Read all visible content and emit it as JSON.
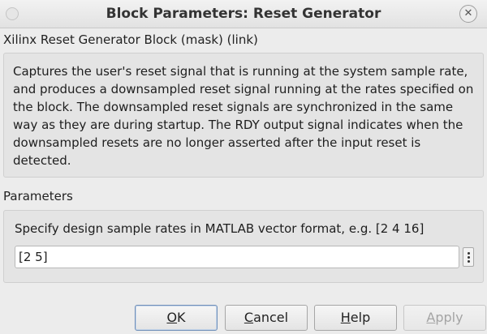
{
  "window": {
    "title": "Block Parameters: Reset Generator",
    "close_icon": "close-icon"
  },
  "block_name": "Xilinx Reset Generator Block (mask) (link)",
  "description": "Captures the user's reset signal that is running at the system sample rate, and produces a downsampled reset signal running at the rates specified on the block.  The downsampled reset signals are synchronized in the same way as they are during startup.  The RDY output signal indicates when the downsampled resets are no longer asserted after the input reset is detected.",
  "parameters": {
    "section_label": "Parameters",
    "label": "Specify design sample rates in MATLAB vector format, e.g. [2  4 16]",
    "value": "[2 5]",
    "menu_icon": "vertical-ellipsis-icon"
  },
  "buttons": {
    "ok": {
      "mnemonic": "O",
      "rest": "K"
    },
    "cancel": {
      "mnemonic": "C",
      "rest": "ancel"
    },
    "help": {
      "mnemonic": "H",
      "rest": "elp"
    },
    "apply": {
      "mnemonic": "A",
      "rest": "pply",
      "enabled": false
    }
  }
}
